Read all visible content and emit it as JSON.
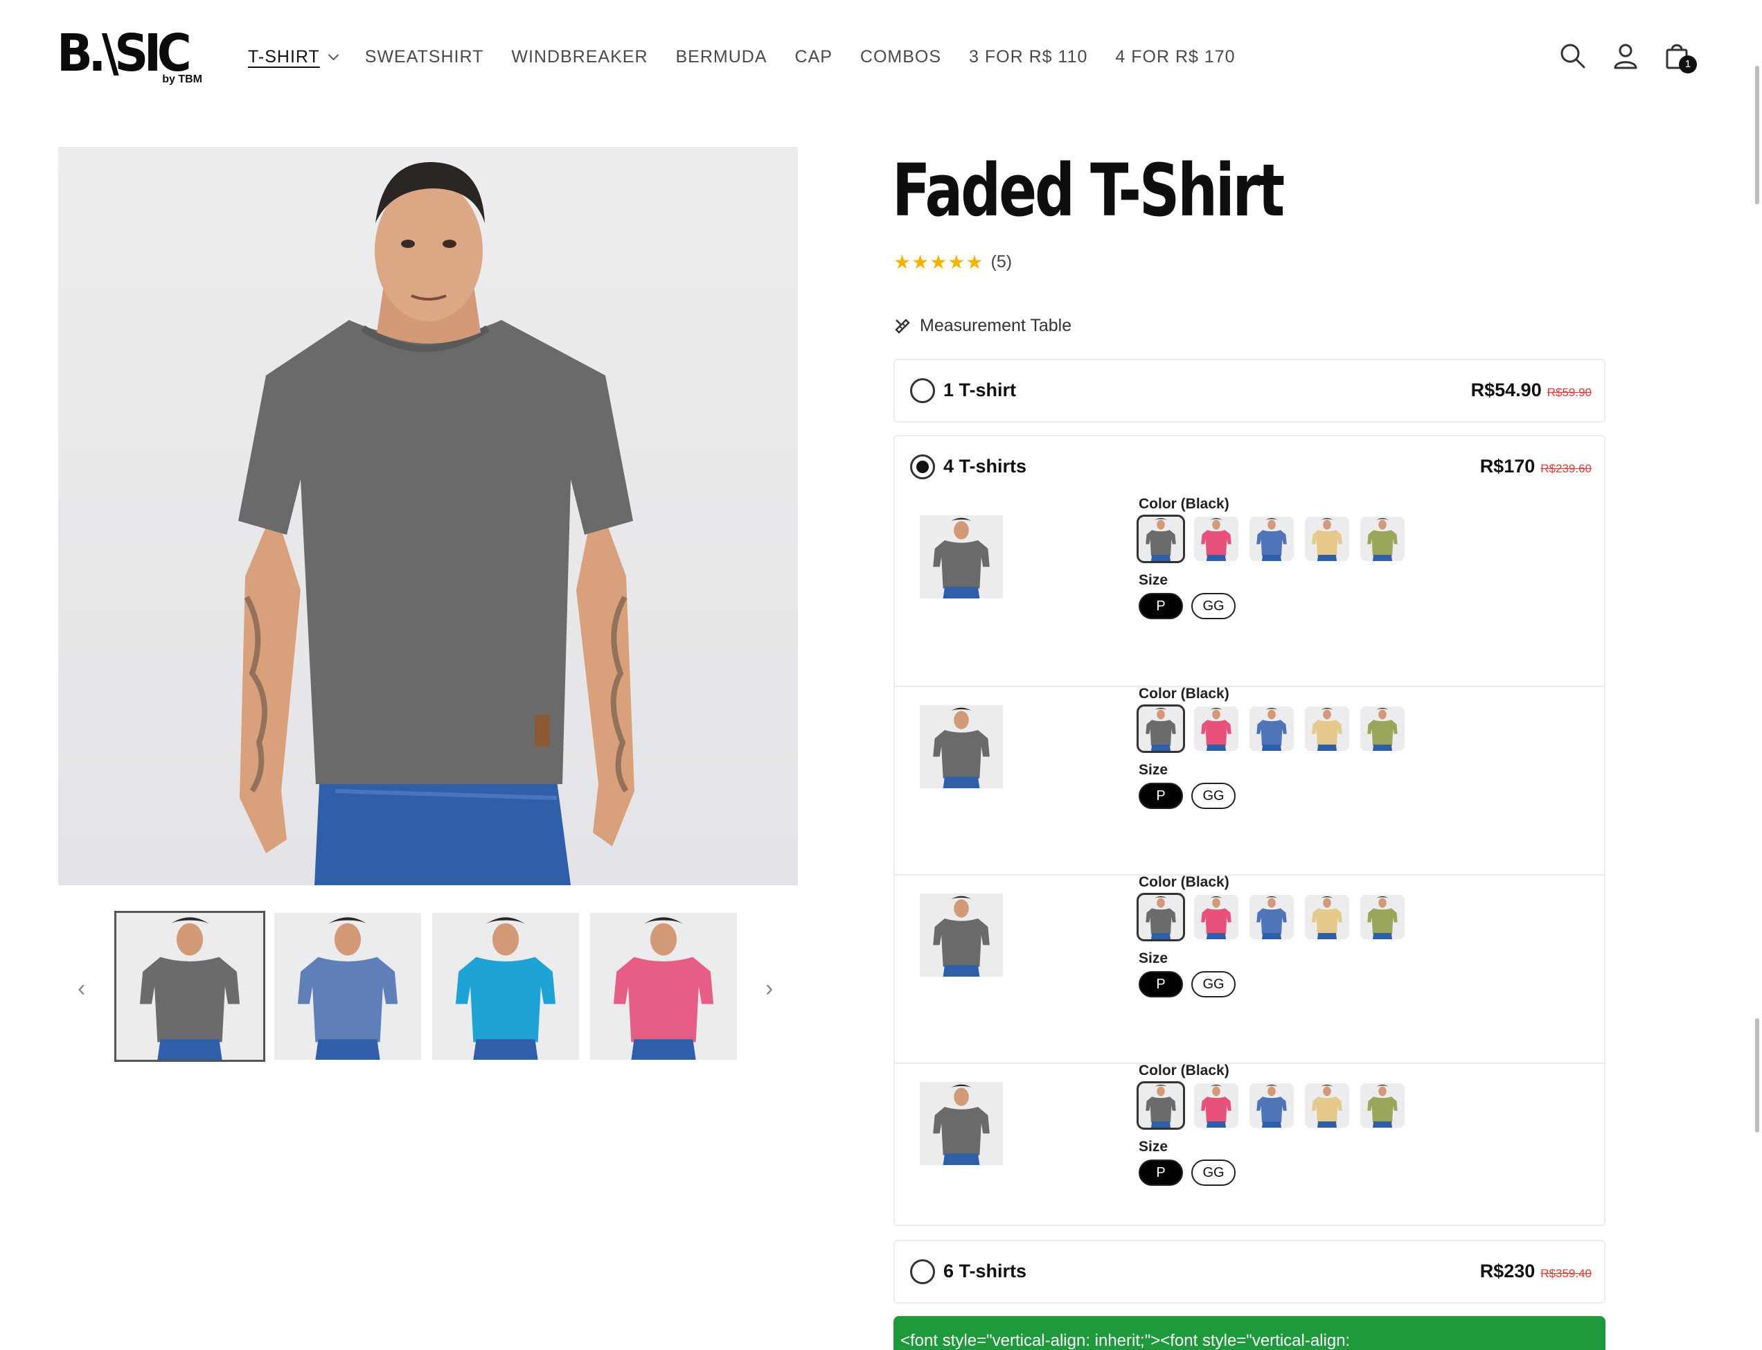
{
  "header": {
    "logo_text": "B.\\SIC",
    "logo_sub": "by TBM",
    "nav": [
      {
        "label": "T-SHIRT",
        "has_dropdown": true,
        "active": true
      },
      {
        "label": "SWEATSHIRT"
      },
      {
        "label": "WINDBREAKER"
      },
      {
        "label": "BERMUDA"
      },
      {
        "label": "CAP"
      },
      {
        "label": "COMBOS"
      },
      {
        "label": "3 FOR R$ 110"
      },
      {
        "label": "4 FOR R$ 170"
      }
    ],
    "icons": [
      "search-icon",
      "account-icon",
      "cart-icon"
    ],
    "cart_count": "1"
  },
  "gallery": {
    "thumbnail_colors": [
      "#6b6b6b",
      "#5f7fb8",
      "#1fa3d6",
      "#e65d86"
    ],
    "prev_arrow": "‹",
    "next_arrow": "›"
  },
  "product": {
    "title": "Faded T-Shirt",
    "stars": "★★★★★",
    "rating_count": "(5)",
    "measurement_link": "Measurement Table",
    "options": [
      {
        "label": "1 T-shirt",
        "price": "R$54.90",
        "old_price": "R$59.90",
        "selected": false
      },
      {
        "label": "4 T-shirts",
        "price": "R$170",
        "old_price": "R$239.60",
        "selected": true
      },
      {
        "label": "6 T-shirts",
        "price": "R$230",
        "old_price": "R$359.40",
        "selected": false
      }
    ],
    "variants": [
      {
        "color_label": "Color (Black)",
        "size_label": "Size",
        "sizes": [
          "P",
          "GG"
        ],
        "selected_size": "P"
      },
      {
        "color_label": "Color (Black)",
        "size_label": "Size",
        "sizes": [
          "P",
          "GG"
        ],
        "selected_size": "P"
      },
      {
        "color_label": "Color (Black)",
        "size_label": "Size",
        "sizes": [
          "P",
          "GG"
        ],
        "selected_size": "P"
      },
      {
        "color_label": "Color (Black)",
        "size_label": "Size",
        "sizes": [
          "P",
          "GG"
        ],
        "selected_size": "P"
      }
    ],
    "swatch_colors": [
      "#6b6b6b",
      "#e8517a",
      "#4f74b8",
      "#e6c98a",
      "#9aa65a"
    ],
    "green_bar_text": "<font style=\"vertical-align: inherit;\"><font style=\"vertical-align:"
  },
  "colors": {
    "accent_green": "#1e9a3c",
    "old_price_red": "#e53935",
    "star_yellow": "#f5b301"
  }
}
